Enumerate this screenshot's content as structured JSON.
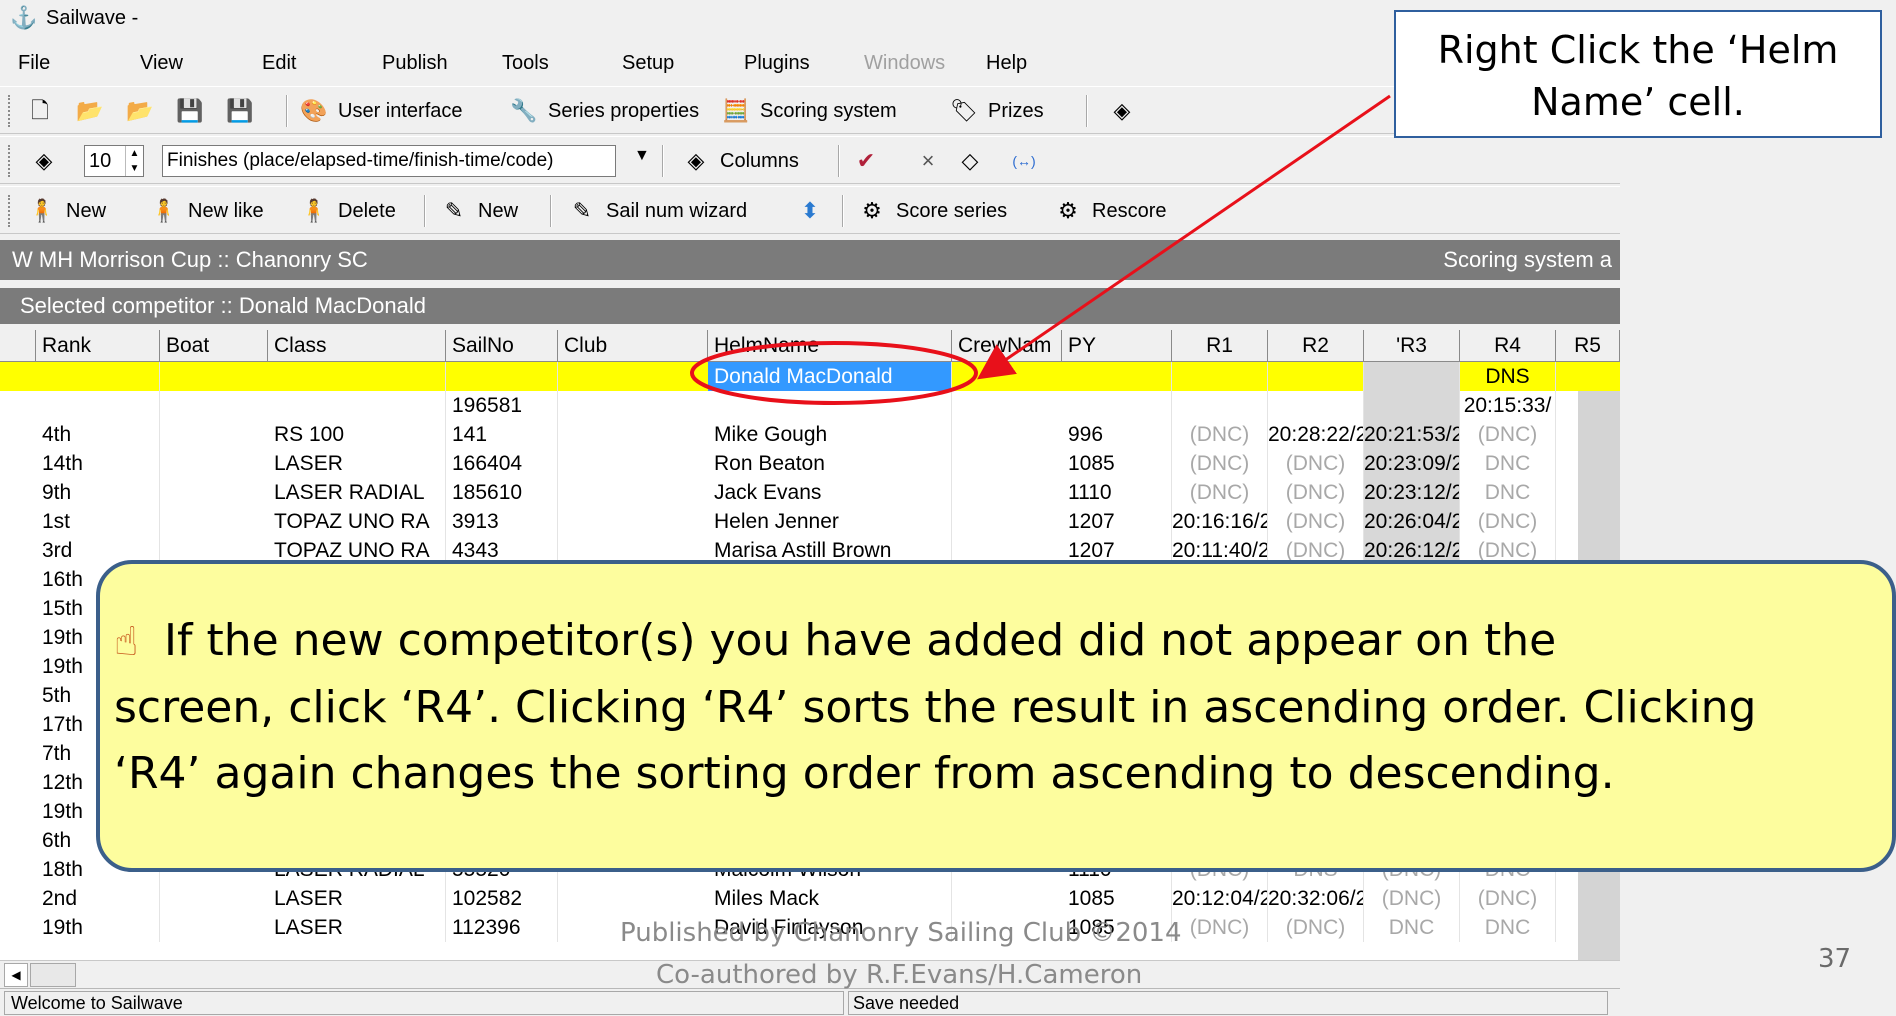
{
  "titlebar": {
    "title": "Sailwave -"
  },
  "menu": [
    "File",
    "View",
    "Edit",
    "Publish",
    "Tools",
    "Setup",
    "Plugins",
    "Windows",
    "Help"
  ],
  "toolbar1": {
    "user_interface": "User interface",
    "series_properties": "Series properties",
    "scoring_system": "Scoring system",
    "prizes": "Prizes"
  },
  "toolbar2": {
    "count": "10",
    "finishes_mode": "Finishes (place/elapsed-time/finish-time/code)",
    "columns": "Columns",
    "close_x": "×",
    "arrows": "(↔)"
  },
  "toolbar3": {
    "new": "New",
    "new_like": "New like",
    "delete": "Delete",
    "new2": "New",
    "sail_num_wizard": "Sail num wizard",
    "score_series": "Score series",
    "rescore": "Rescore"
  },
  "event_bar": {
    "title": "W MH Morrison Cup :: Chanonry SC",
    "right": "Scoring system a"
  },
  "selected_bar": {
    "text": "Selected competitor :: Donald MacDonald"
  },
  "grid": {
    "headers": [
      "Rank",
      "Boat",
      "Class",
      "SailNo",
      "Club",
      "HelmName",
      "CrewNam",
      "PY",
      "R1",
      "R2",
      "'R3",
      "R4",
      "R5"
    ],
    "rows": [
      {
        "rank": "",
        "class": "",
        "sailno": "",
        "helm": "Donald MacDonald",
        "py": "",
        "r1": "",
        "r2": "",
        "r3": "",
        "r4": "DNS"
      },
      {
        "rank": "",
        "class": "",
        "sailno": "196581",
        "helm": "",
        "py": "",
        "r1": "",
        "r2": "",
        "r3": "",
        "r4": "20:15:33/"
      },
      {
        "rank": "4th",
        "class": "RS 100",
        "sailno": "141",
        "helm": "Mike Gough",
        "py": "996",
        "r1": "(DNC)",
        "r2": "20:28:22/2",
        "r3": "20:21:53/2",
        "r4": "(DNC)"
      },
      {
        "rank": "14th",
        "class": "LASER",
        "sailno": "166404",
        "helm": "Ron Beaton",
        "py": "1085",
        "r1": "(DNC)",
        "r2": "(DNC)",
        "r3": "20:23:09/2",
        "r4": "DNC"
      },
      {
        "rank": "9th",
        "class": "LASER RADIAL",
        "sailno": "185610",
        "helm": "Jack Evans",
        "py": "1110",
        "r1": "(DNC)",
        "r2": "(DNC)",
        "r3": "20:23:12/2",
        "r4": "DNC"
      },
      {
        "rank": "1st",
        "class": "TOPAZ UNO RA",
        "sailno": "3913",
        "helm": "Helen Jenner",
        "py": "1207",
        "r1": "20:16:16/2",
        "r2": "(DNC)",
        "r3": "20:26:04/2",
        "r4": "(DNC)"
      },
      {
        "rank": "3rd",
        "class": "TOPAZ UNO RA",
        "sailno": "4343",
        "helm": "Marisa Astill Brown",
        "py": "1207",
        "r1": "20:11:40/2",
        "r2": "(DNC)",
        "r3": "20:26:12/2",
        "r4": "(DNC)"
      },
      {
        "rank": "16th",
        "class": "",
        "sailno": "",
        "helm": "",
        "py": "",
        "r1": "",
        "r2": "",
        "r3": "",
        "r4": ""
      },
      {
        "rank": "15th",
        "class": "",
        "sailno": "",
        "helm": "",
        "py": "",
        "r1": "",
        "r2": "",
        "r3": "",
        "r4": ""
      },
      {
        "rank": "19th",
        "class": "",
        "sailno": "",
        "helm": "",
        "py": "",
        "r1": "",
        "r2": "",
        "r3": "",
        "r4": ""
      },
      {
        "rank": "19th",
        "class": "",
        "sailno": "",
        "helm": "",
        "py": "",
        "r1": "",
        "r2": "",
        "r3": "",
        "r4": ""
      },
      {
        "rank": "5th",
        "class": "",
        "sailno": "",
        "helm": "",
        "py": "",
        "r1": "",
        "r2": "",
        "r3": "",
        "r4": ""
      },
      {
        "rank": "17th",
        "class": "",
        "sailno": "",
        "helm": "",
        "py": "",
        "r1": "",
        "r2": "",
        "r3": "",
        "r4": ""
      },
      {
        "rank": "7th",
        "class": "",
        "sailno": "",
        "helm": "",
        "py": "",
        "r1": "",
        "r2": "",
        "r3": "",
        "r4": ""
      },
      {
        "rank": "12th",
        "class": "",
        "sailno": "",
        "helm": "",
        "py": "",
        "r1": "",
        "r2": "",
        "r3": "",
        "r4": ""
      },
      {
        "rank": "19th",
        "class": "",
        "sailno": "",
        "helm": "",
        "py": "",
        "r1": "",
        "r2": "",
        "r3": "",
        "r4": ""
      },
      {
        "rank": "6th",
        "class": "",
        "sailno": "",
        "helm": "",
        "py": "",
        "r1": "",
        "r2": "",
        "r3": "",
        "r4": ""
      },
      {
        "rank": "18th",
        "class": "LASER RADIAL",
        "sailno": "55520",
        "helm": "Malcolm Wilson",
        "py": "1110",
        "r1": "(DNC)",
        "r2": "DNS",
        "r3": "(DNC)",
        "r4": "DNC"
      },
      {
        "rank": "2nd",
        "class": "LASER",
        "sailno": "102582",
        "helm": "Miles Mack",
        "py": "1085",
        "r1": "20:12:04/2",
        "r2": "20:32:06/2",
        "r3": "(DNC)",
        "r4": "(DNC)"
      },
      {
        "rank": "19th",
        "class": "LASER",
        "sailno": "112396",
        "helm": "David Finlayson",
        "py": "1085",
        "r1": "(DNC)",
        "r2": "(DNC)",
        "r3": "DNC",
        "r4": "DNC"
      }
    ]
  },
  "statusbar": {
    "left": "Welcome to Sailwave",
    "right": "Save needed"
  },
  "callout_top": {
    "line1": "Right Click  the ‘Helm",
    "line2": "Name’ cell."
  },
  "callout_bottom": {
    "line1": " If the new competitor(s) you have added did not appear on the",
    "line2": "screen, click ‘R4’. Clicking ‘R4’ sorts the result in ascending order. Clicking",
    "line3": "‘R4’ again changes the sorting order from ascending to descending."
  },
  "footer": {
    "line1": "Published by Chanonry Sailing Club ©2014",
    "line2": "Co-authored by R.F.Evans/H.Cameron"
  },
  "page_number": "37",
  "colors": {
    "highlight_row": "#ffff00",
    "selected_cell": "#3399ff",
    "header_bar": "#7b7b7b",
    "callout_fill": "#fdfd9e",
    "callout_border": "#3b5f8a",
    "annotation_red": "#e8101a"
  },
  "icons": [
    "sailwave-app-icon",
    "new-doc-icon",
    "open-icon",
    "save-icon",
    "user-interface-icon",
    "series-properties-icon",
    "scoring-system-icon",
    "prizes-icon",
    "columns-icon",
    "new-competitor-icon",
    "delete-icon",
    "sail-num-wizard-icon",
    "score-series-icon",
    "rescore-icon",
    "pointing-hand-icon"
  ]
}
